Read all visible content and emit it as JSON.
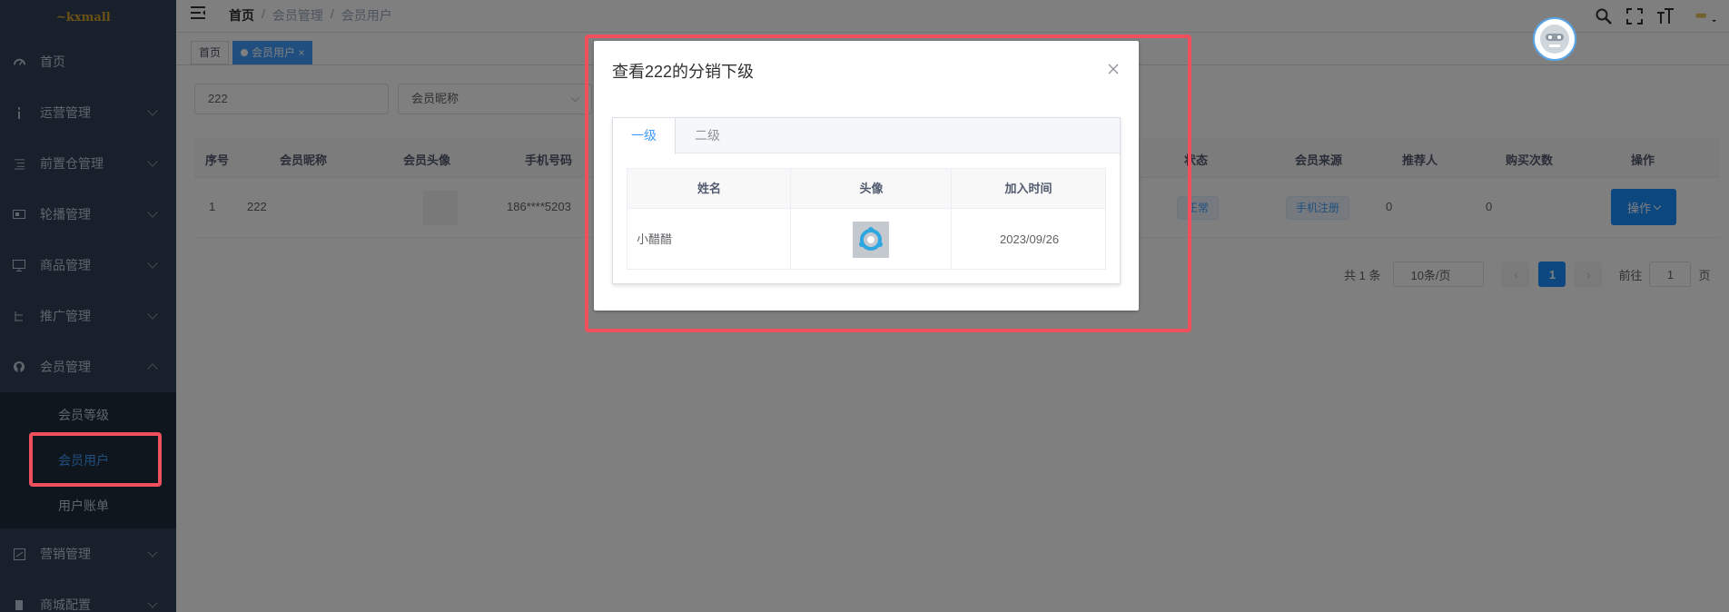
{
  "sidebar": {
    "logo_text": "~kxmall",
    "items": [
      {
        "label": "首页",
        "icon": "dashboard-icon"
      },
      {
        "label": "运营管理",
        "icon": "info-icon"
      },
      {
        "label": "前置仓管理",
        "icon": "list-icon"
      },
      {
        "label": "轮播管理",
        "icon": "carousel-icon"
      },
      {
        "label": "商品管理",
        "icon": "monitor-icon"
      },
      {
        "label": "推广管理",
        "icon": "tree-icon"
      },
      {
        "label": "会员管理",
        "icon": "github-icon"
      },
      {
        "label": "营销管理",
        "icon": "chart-icon"
      },
      {
        "label": "商城配置",
        "icon": "config-icon"
      }
    ],
    "submenu": [
      "会员等级",
      "会员用户",
      "用户账单"
    ]
  },
  "navbar": {
    "breadcrumb": [
      "首页",
      "会员管理",
      "会员用户"
    ],
    "separator": "/"
  },
  "tags": {
    "home": "首页",
    "current": "会员用户",
    "close": "×"
  },
  "filters": {
    "search_value": "222",
    "nickname_placeholder": "会员昵称"
  },
  "table": {
    "headers": [
      "序号",
      "会员昵称",
      "会员头像",
      "手机号码",
      "状态",
      "会员来源",
      "推荐人",
      "购买次数",
      "操作"
    ],
    "row": {
      "index": "1",
      "nickname": "222",
      "phone": "186****5203",
      "status": "正常",
      "source": "手机注册",
      "referrer": "0",
      "purchases": "0",
      "op": "操作"
    }
  },
  "pagination": {
    "total": "共 1 条",
    "page_size": "10条/页",
    "current_page": "1",
    "goto_prefix": "前往",
    "goto_value": "1",
    "goto_suffix": "页"
  },
  "dialog": {
    "title": "查看222的分销下级",
    "tabs": [
      "一级",
      "二级"
    ],
    "columns": [
      "姓名",
      "头像",
      "加入时间"
    ],
    "rows": [
      {
        "name": "小醋醋",
        "joined": "2023/09/26"
      }
    ]
  },
  "colors": {
    "sidebar_bg": "#304156",
    "accent": "#409eff",
    "highlight": "#f0505e"
  }
}
